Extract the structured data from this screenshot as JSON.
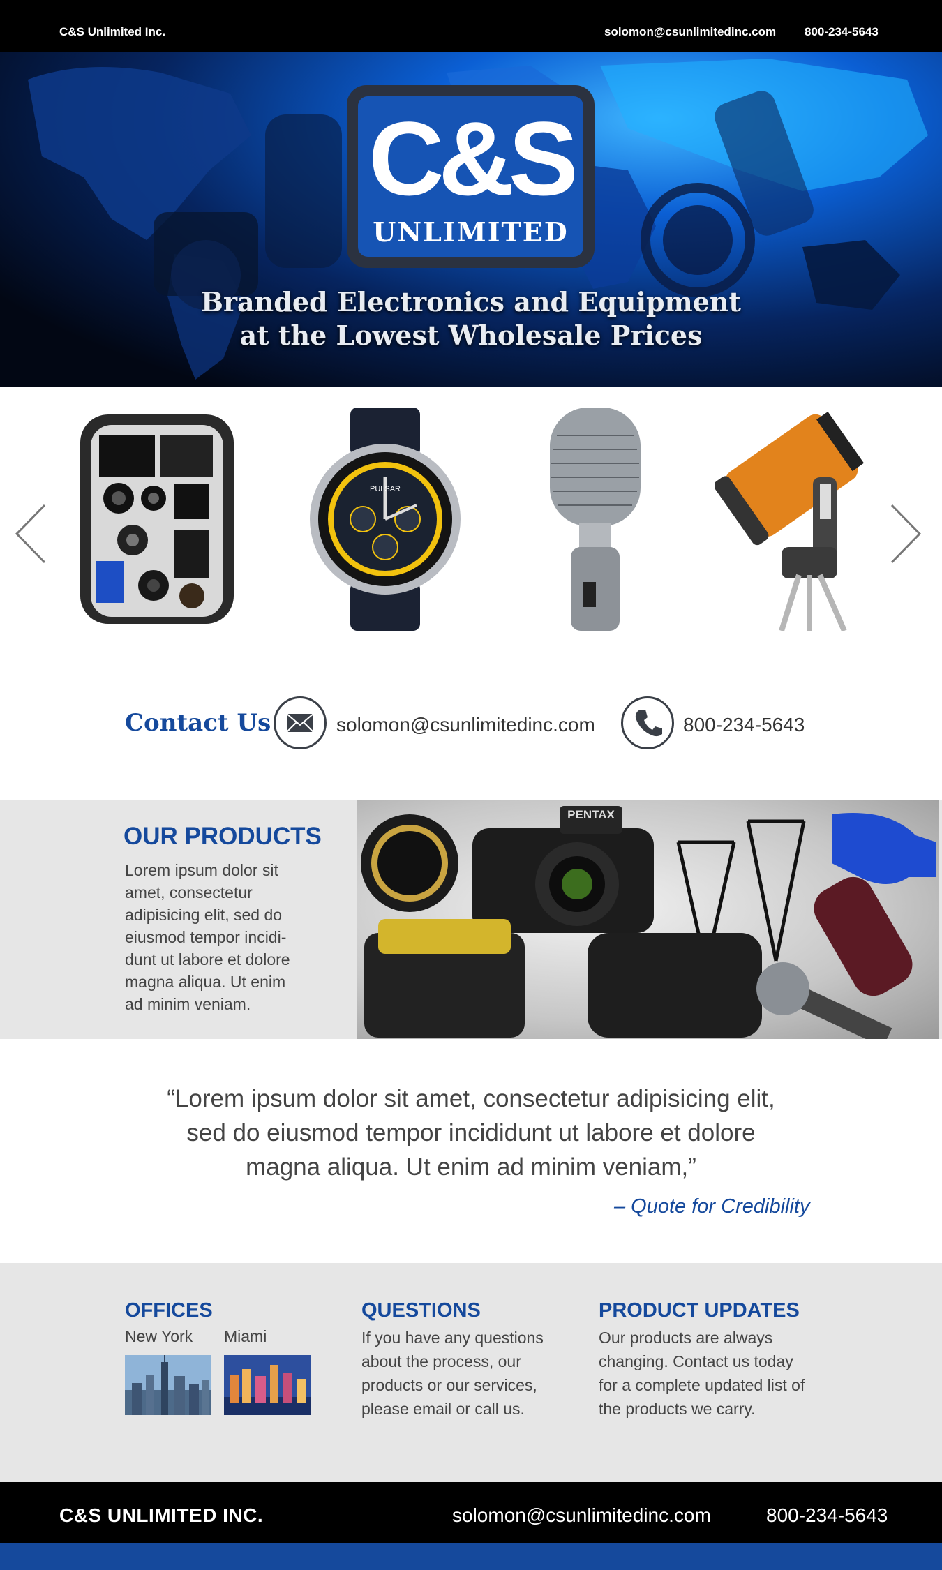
{
  "topbar": {
    "brand": "C&S Unlimited Inc.",
    "email": "solomon@csunlimitedinc.com",
    "phone": "800-234-5643"
  },
  "hero": {
    "logo_mark": "C&S",
    "logo_word": "UNLIMITED",
    "tagline_line1": "Branded Electronics and Equipment",
    "tagline_line2": "at the Lowest Wholesale Prices"
  },
  "carousel": {
    "prev_icon": "chevron-left-icon",
    "next_icon": "chevron-right-icon",
    "items": [
      {
        "name": "camera-backpack-image"
      },
      {
        "name": "pulsar-watch-image",
        "brand_text": "PULSAR"
      },
      {
        "name": "microphone-image"
      },
      {
        "name": "telescope-image"
      }
    ]
  },
  "contact": {
    "title": "Contact Us",
    "email": "solomon@csunlimitedinc.com",
    "phone": "800-234-5643",
    "email_icon": "envelope-icon",
    "phone_icon": "phone-icon"
  },
  "products": {
    "title": "OUR PRODUCTS",
    "text": "Lorem ipsum dolor sit amet, consectetur adipisicing elit, sed do eiusmod tempor incidi-dunt ut labore et dolore magna aliqua. Ut enim ad minim veniam.",
    "camera_brand": "PENTAX"
  },
  "quote": {
    "line1": "“Lorem ipsum dolor sit amet, consectetur adipisicing elit,",
    "line2": "sed do eiusmod tempor incididunt ut labore et dolore",
    "line3": "magna aliqua. Ut enim ad minim veniam,”",
    "attribution": "– Quote for Credibility"
  },
  "info": {
    "offices": {
      "title": "OFFICES",
      "cities": [
        "New York",
        "Miami"
      ]
    },
    "questions": {
      "title": "QUESTIONS",
      "text": "If you have any questions about the process, our products or our services, please email or call us."
    },
    "updates": {
      "title": "PRODUCT UPDATES",
      "text": "Our products are always changing. Contact us today for a complete updated list of the products we carry."
    }
  },
  "footer": {
    "brand": "C&S UNLIMITED INC.",
    "email": "solomon@csunlimitedinc.com",
    "phone": "800-234-5643"
  },
  "colors": {
    "brand_blue": "#15499c",
    "black": "#000000",
    "light_gray": "#e6e6e6"
  }
}
